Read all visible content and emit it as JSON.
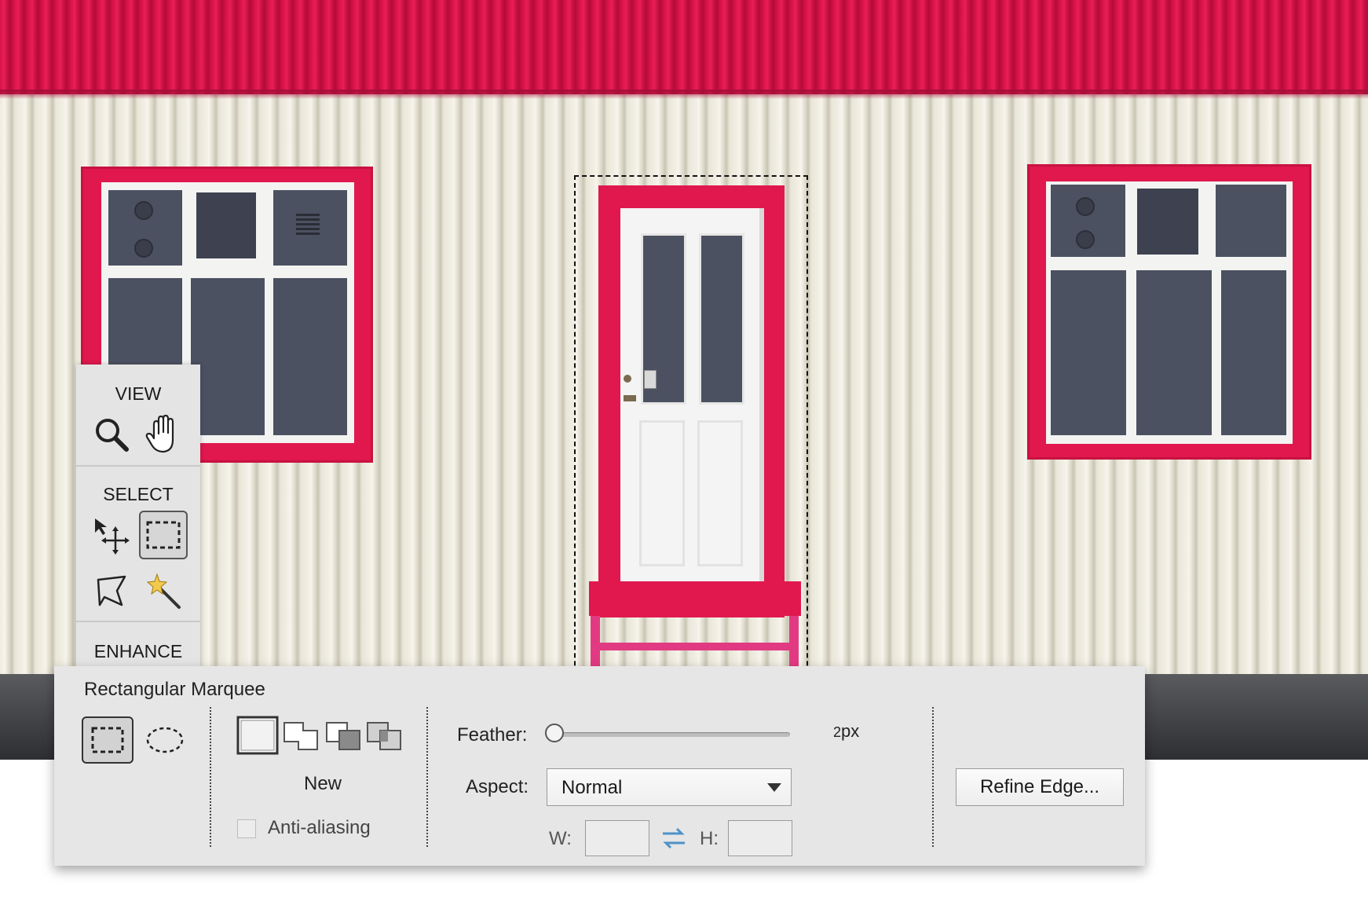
{
  "photo": {
    "description_colors": {
      "roof": "#d8134a",
      "wall": "#efece0",
      "trim": "#e0184e",
      "glass": "#4c5161"
    }
  },
  "tools_panel": {
    "view_title": "VIEW",
    "select_title": "SELECT",
    "enhance_title": "ENHANCE",
    "tools": [
      {
        "icon": "zoom-icon"
      },
      {
        "icon": "hand-icon"
      },
      {
        "icon": "move-icon"
      },
      {
        "icon": "rectangular-marquee-icon",
        "active": true
      },
      {
        "icon": "lasso-icon"
      },
      {
        "icon": "magic-wand-icon"
      }
    ]
  },
  "options_bar": {
    "tool_name": "Rectangular Marquee",
    "selection_mode_label": "New",
    "anti_aliasing_label": "Anti-aliasing",
    "anti_aliasing_checked": false,
    "feather_label": "Feather:",
    "feather_value": "2",
    "feather_unit": "px",
    "feather_fraction": 0.0,
    "aspect_label": "Aspect:",
    "aspect_value": "Normal",
    "w_label": "W:",
    "h_label": "H:",
    "w_value": "",
    "h_value": "",
    "refine_edge_label": "Refine Edge..."
  }
}
